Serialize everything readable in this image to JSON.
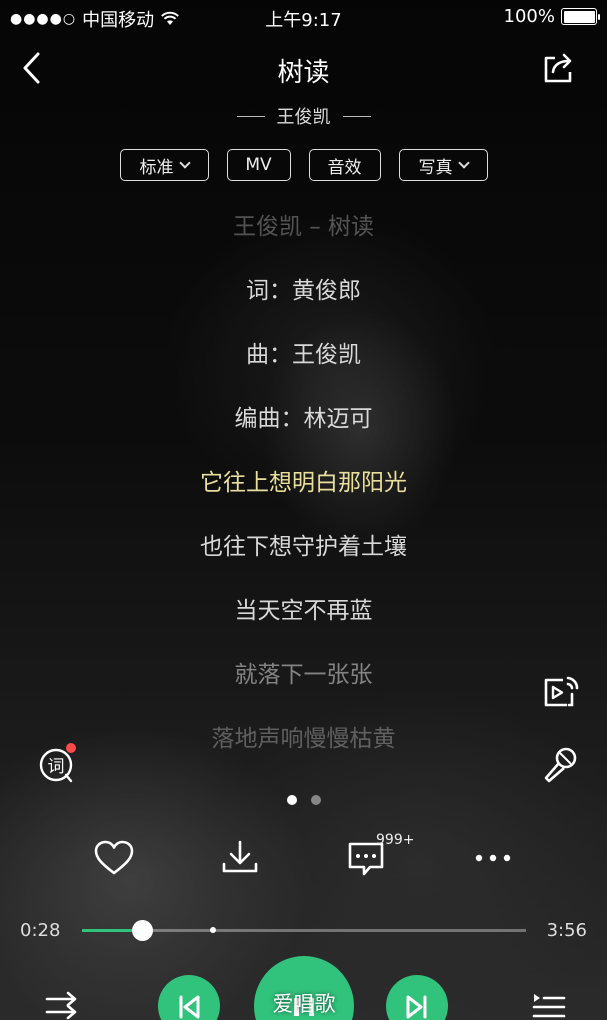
{
  "status_bar": {
    "signal_dots": "●●●●○",
    "carrier": "中国移动",
    "wifi_icon": "wifi-icon",
    "time": "上午9:17",
    "battery": "100%",
    "battery_level": 1.0
  },
  "header": {
    "title": "树读",
    "artist": "王俊凯"
  },
  "chips": [
    {
      "label": "标准",
      "has_dropdown": true
    },
    {
      "label": "MV",
      "has_dropdown": false
    },
    {
      "label": "音效",
      "has_dropdown": false
    },
    {
      "label": "写真",
      "has_dropdown": true
    }
  ],
  "lyrics": [
    {
      "text": "王俊凯 – 树读",
      "state": "dim1"
    },
    {
      "text": "词：黄俊郎",
      "state": "normal"
    },
    {
      "text": "曲：王俊凯",
      "state": "normal"
    },
    {
      "text": "编曲：林迈可",
      "state": "normal"
    },
    {
      "text": "它往上想明白那阳光",
      "state": "active"
    },
    {
      "text": "也往下想守护着土壤",
      "state": "normal"
    },
    {
      "text": "当天空不再蓝",
      "state": "normal"
    },
    {
      "text": "就落下一张张",
      "state": "dim2"
    },
    {
      "text": "落地声响慢慢枯黄",
      "state": "dim1"
    }
  ],
  "side": {
    "lyric_button_label": "词",
    "pager_active": 0,
    "pager_count": 2
  },
  "actions": {
    "comment_count": "999+"
  },
  "progress": {
    "elapsed": "0:28",
    "duration": "3:56",
    "fraction": 0.135,
    "buffered_fraction": 0.295
  },
  "watermark": "爱唱歌",
  "colors": {
    "accent": "#31c27c",
    "active_lyric": "#e9df9c",
    "badge": "#ff4a4a"
  }
}
